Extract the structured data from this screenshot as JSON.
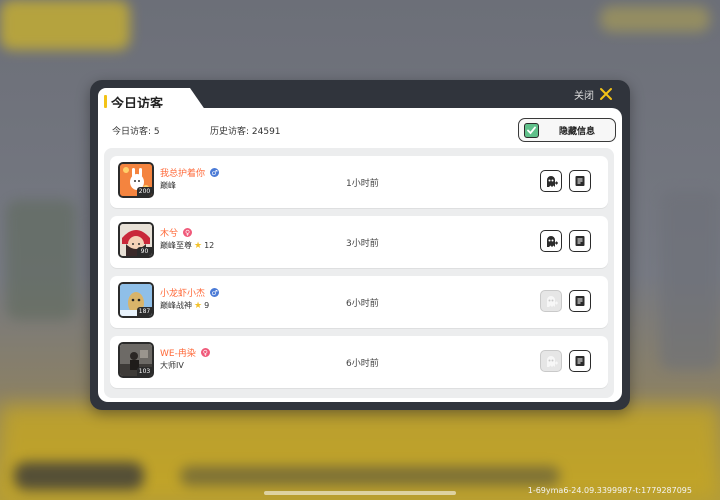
{
  "dialog": {
    "tab_title": "今日访客",
    "close_label": "关闭",
    "today_visitors": "今日访客: 5",
    "history_visitors": "历史访客: 24591",
    "hide_info_label": "隐藏信息",
    "hide_info_checked": true
  },
  "visitors": [
    {
      "name": "我总护着你",
      "gender": "male",
      "rank": "巅峰",
      "stars": "",
      "level": "200",
      "time": "1小时前",
      "visit_enabled": true
    },
    {
      "name": "木兮",
      "gender": "female",
      "rank": "巅峰至尊",
      "stars": "12",
      "level": "90",
      "time": "3小时前",
      "visit_enabled": true
    },
    {
      "name": "小龙虾小杰",
      "gender": "male",
      "rank": "巅峰战神",
      "stars": "9",
      "level": "187",
      "time": "6小时前",
      "visit_enabled": false
    },
    {
      "name": "WE-冉染",
      "gender": "female",
      "rank": "大师IV",
      "stars": "",
      "level": "103",
      "time": "6小时前",
      "visit_enabled": false
    }
  ],
  "footer": {
    "version": "1-69yma6-24.09.3399987-t:1779287095"
  },
  "colors": {
    "accent_yellow": "#f3c317",
    "name_orange": "#ff6a3a",
    "male_blue": "#4a7ad6",
    "female_pink": "#f05a7a",
    "check_green": "#5fc08a"
  }
}
